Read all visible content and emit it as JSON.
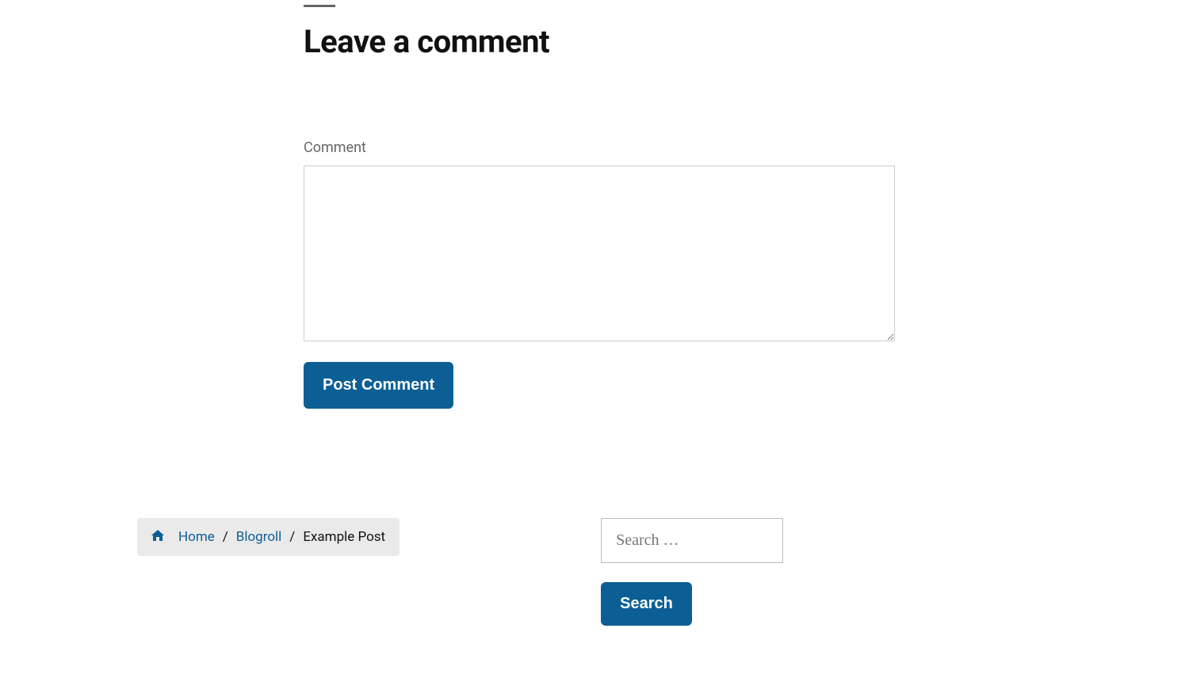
{
  "commentSection": {
    "heading": "Leave a comment",
    "label": "Comment",
    "submitLabel": "Post Comment"
  },
  "breadcrumb": {
    "home": "Home",
    "category": "Blogroll",
    "current": "Example Post",
    "separator": "/"
  },
  "search": {
    "placeholder": "Search …",
    "buttonLabel": "Search"
  }
}
